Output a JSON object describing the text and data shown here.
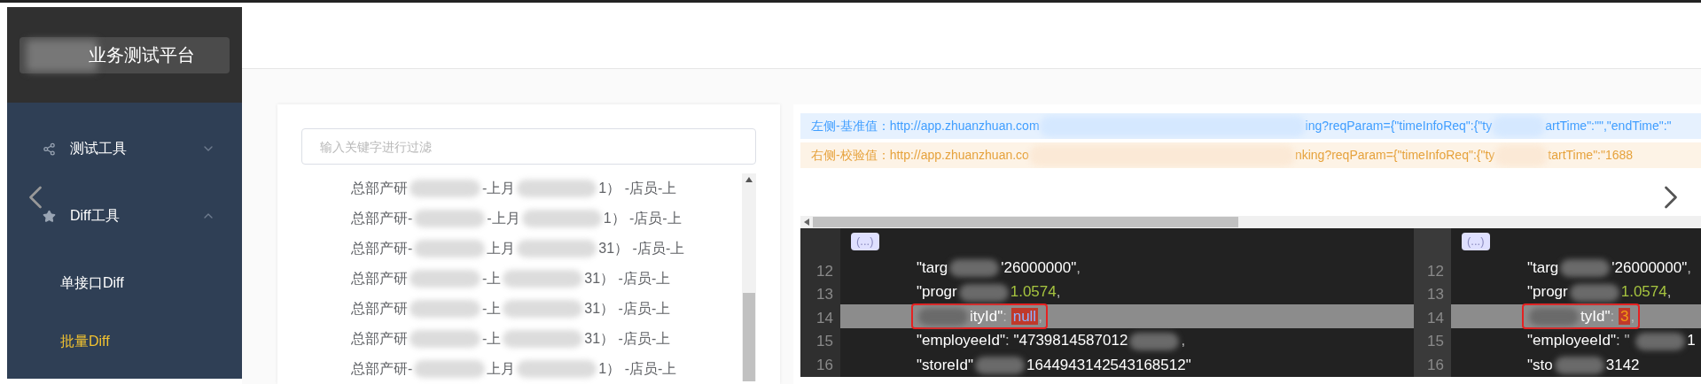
{
  "sidebar": {
    "logo": "业务测试平台",
    "items": [
      {
        "label": "测试工具",
        "expanded": false
      },
      {
        "label": "Diff工具",
        "expanded": true,
        "children": [
          {
            "label": "单接口Diff",
            "selected": false
          },
          {
            "label": "批量Diff",
            "selected": true
          }
        ]
      }
    ]
  },
  "filter": {
    "placeholder": "输入关键字进行过滤",
    "rows": [
      [
        "总部产研",
        "-上月",
        "1） -店员-上"
      ],
      [
        "总部产研-",
        "-上月",
        "1） -店员-上"
      ],
      [
        "总部产研-",
        "上月",
        "31） -店员-上"
      ],
      [
        "总部产研",
        "-上",
        "31） -店员-上"
      ],
      [
        "总部产研",
        "-上",
        "31） -店员-上"
      ],
      [
        "总部产研",
        "-上",
        "31） -店员-上"
      ],
      [
        "总部产研-",
        "上月",
        "1） -店员-上"
      ]
    ]
  },
  "diff": {
    "bars": [
      {
        "kind": "base",
        "label": "左侧-基准值：",
        "parts": [
          "http://app.zhuanzhuan.com",
          "ing?reqParam={\"timeInfoReq\":{\"ty",
          "artTime\":\"\",\"endTime\":\""
        ]
      },
      {
        "kind": "check",
        "label": "右侧-校验值：",
        "parts": [
          "http://app.zhuanzhuan.co",
          "nking?reqParam={\"timeInfoReq\":{\"ty",
          "tartTime\":\"1688"
        ]
      }
    ],
    "panes": [
      {
        "fold": "(...)",
        "lines": [
          {
            "number": "12",
            "changed": false,
            "segments": [
              {
                "kind": "key",
                "text": "\"targ"
              },
              {
                "kind": "blur"
              },
              {
                "kind": "key",
                "text": "'26000000\""
              },
              {
                "kind": "punct",
                "text": ","
              }
            ]
          },
          {
            "number": "13",
            "changed": false,
            "segments": [
              {
                "kind": "key",
                "text": "\"progr"
              },
              {
                "kind": "blur"
              },
              {
                "kind": "number",
                "text": "1.0574"
              },
              {
                "kind": "punct",
                "text": ","
              }
            ]
          },
          {
            "number": "14",
            "changed": true,
            "segments": [
              {
                "kind": "blur"
              },
              {
                "kind": "key",
                "text": "ityId\""
              },
              {
                "kind": "punct",
                "text": ":"
              },
              {
                "kind": "null",
                "text": "null"
              },
              {
                "kind": "punct",
                "text": ","
              }
            ]
          },
          {
            "number": "15",
            "changed": false,
            "segments": [
              {
                "kind": "key",
                "text": "\"employeeId\""
              },
              {
                "kind": "punct",
                "text": ":"
              },
              {
                "kind": "key",
                "text": "\"4739814587012"
              },
              {
                "kind": "blur"
              },
              {
                "kind": "punct",
                "text": ","
              }
            ]
          },
          {
            "number": "16",
            "changed": false,
            "segments": [
              {
                "kind": "key",
                "text": "\"storeId\""
              },
              {
                "kind": "blur"
              },
              {
                "kind": "key",
                "text": "1644943142543168512\""
              }
            ]
          }
        ]
      },
      {
        "fold": "(...)",
        "lines": [
          {
            "number": "12",
            "changed": false,
            "segments": [
              {
                "kind": "key",
                "text": "\"targ"
              },
              {
                "kind": "blur"
              },
              {
                "kind": "key",
                "text": "'26000000\""
              },
              {
                "kind": "punct",
                "text": ","
              }
            ]
          },
          {
            "number": "13",
            "changed": false,
            "segments": [
              {
                "kind": "key",
                "text": "\"progr"
              },
              {
                "kind": "blur"
              },
              {
                "kind": "number",
                "text": "1.0574"
              },
              {
                "kind": "punct",
                "text": ","
              }
            ]
          },
          {
            "number": "14",
            "changed": true,
            "segments": [
              {
                "kind": "blur"
              },
              {
                "kind": "key",
                "text": "tyId\""
              },
              {
                "kind": "punct",
                "text": ":"
              },
              {
                "kind": "changed-number",
                "text": "3"
              },
              {
                "kind": "punct",
                "text": ","
              }
            ]
          },
          {
            "number": "15",
            "changed": false,
            "segments": [
              {
                "kind": "key",
                "text": "\"employeeId\""
              },
              {
                "kind": "punct",
                "text": ": \""
              },
              {
                "kind": "blur"
              },
              {
                "kind": "key",
                "text": "1"
              }
            ]
          },
          {
            "number": "16",
            "changed": false,
            "segments": [
              {
                "kind": "key",
                "text": "\"sto"
              },
              {
                "kind": "blur"
              },
              {
                "kind": "key",
                "text": "3142"
              }
            ]
          }
        ]
      }
    ]
  }
}
